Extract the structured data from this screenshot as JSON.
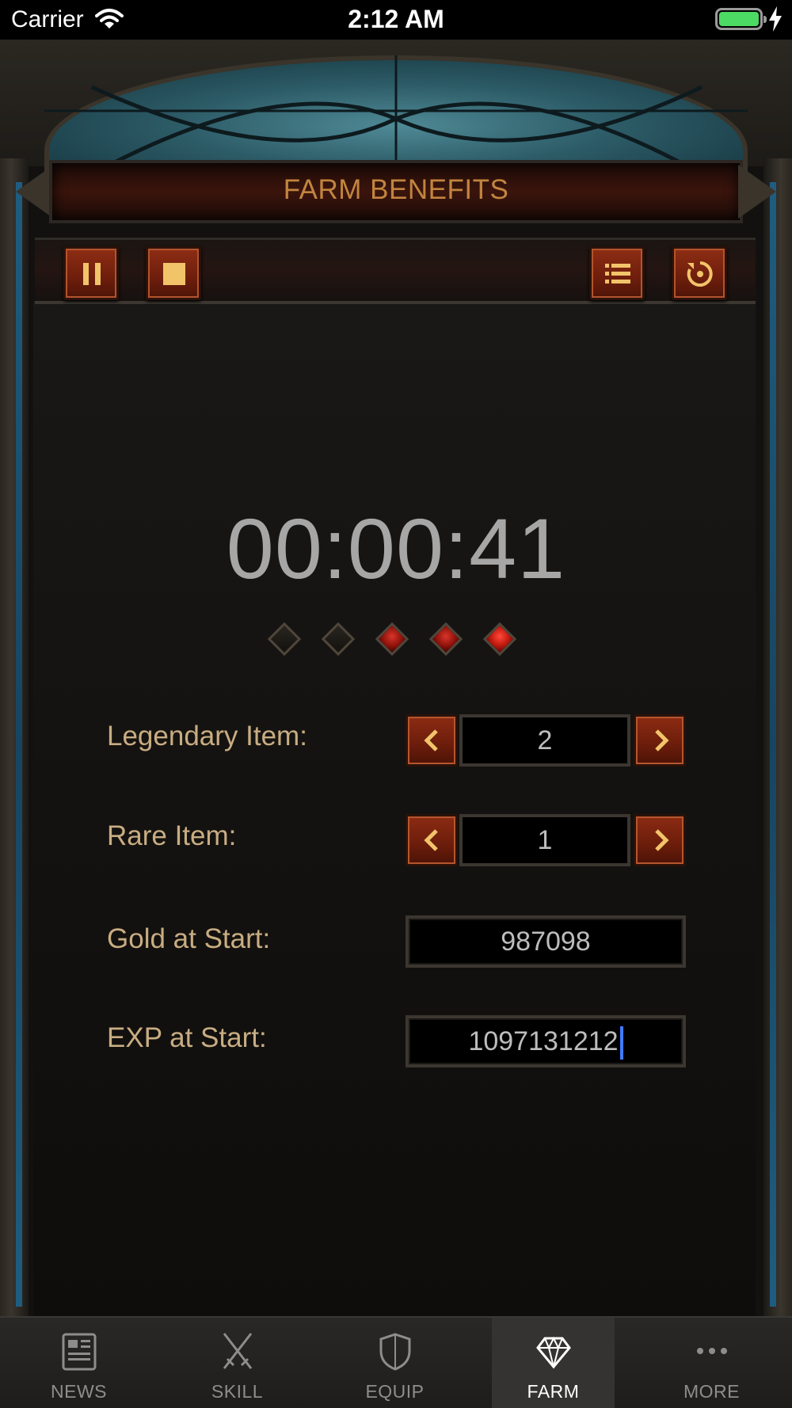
{
  "status_bar": {
    "carrier": "Carrier",
    "time": "2:12 AM"
  },
  "header": {
    "title": "FARM BENEFITS"
  },
  "toolbar": {
    "buttons": [
      {
        "name": "pause",
        "icon": "pause-icon"
      },
      {
        "name": "stop",
        "icon": "stop-icon"
      },
      {
        "name": "list",
        "icon": "list-icon"
      },
      {
        "name": "reset",
        "icon": "reset-icon"
      }
    ]
  },
  "timer": {
    "value": "00:00:41"
  },
  "gem_progress": {
    "total": 5,
    "filled": 3
  },
  "form": {
    "legendary_label": "Legendary Item:",
    "legendary_value": "2",
    "rare_label": "Rare Item:",
    "rare_value": "1",
    "gold_label": "Gold at Start:",
    "gold_value": "987098",
    "exp_label": "EXP at Start:",
    "exp_value": "1097131212"
  },
  "tabs": [
    {
      "label": "NEWS",
      "icon": "newspaper-icon",
      "active": false
    },
    {
      "label": "SKILL",
      "icon": "crossed-swords-icon",
      "active": false
    },
    {
      "label": "EQUIP",
      "icon": "shield-icon",
      "active": false
    },
    {
      "label": "FARM",
      "icon": "diamond-icon",
      "active": true
    },
    {
      "label": "MORE",
      "icon": "more-icon",
      "active": false
    }
  ],
  "colors": {
    "title": "#c2843e",
    "label": "#c8ad82",
    "button_red": "#8e2d14",
    "gem_red": "#c41a10",
    "caret": "#3f7bff"
  }
}
